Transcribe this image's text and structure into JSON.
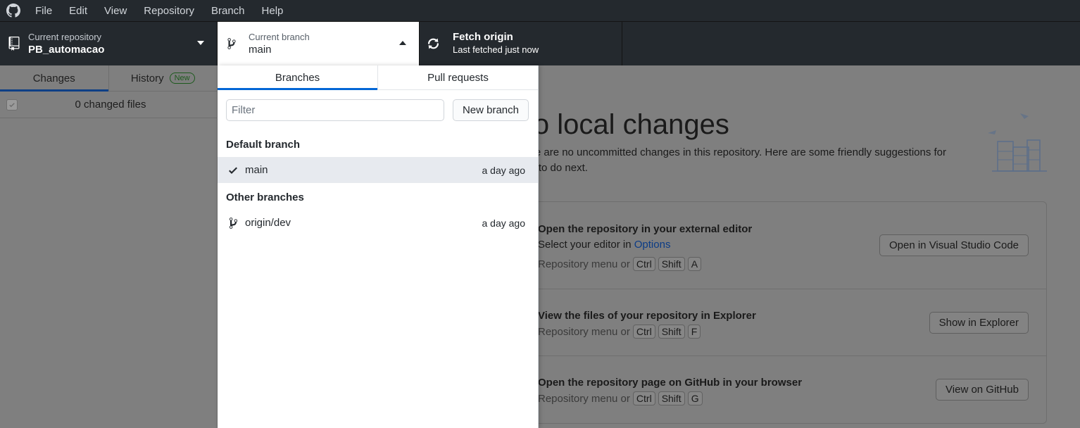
{
  "menubar": {
    "items": [
      "File",
      "Edit",
      "View",
      "Repository",
      "Branch",
      "Help"
    ]
  },
  "toolbar": {
    "repo": {
      "label": "Current repository",
      "value": "PB_automacao"
    },
    "branch": {
      "label": "Current branch",
      "value": "main"
    },
    "fetch": {
      "label": "Fetch origin",
      "sub": "Last fetched just now"
    }
  },
  "sidebar": {
    "tabs": [
      {
        "label": "Changes",
        "active": true
      },
      {
        "label": "History",
        "badge": "New"
      }
    ],
    "changed_files": "0 changed files"
  },
  "main": {
    "title": "No local changes",
    "description": "There are no uncommitted changes in this repository. Here are some friendly suggestions for what to do next.",
    "cards": [
      {
        "title": "Open the repository in your external editor",
        "sub_prefix": "Select your editor in",
        "sub_link": "Options",
        "keys_prefix": "Repository menu or",
        "keys": [
          "Ctrl",
          "Shift",
          "A"
        ],
        "button": "Open in Visual Studio Code"
      },
      {
        "title": "View the files of your repository in Explorer",
        "keys_prefix": "Repository menu or",
        "keys": [
          "Ctrl",
          "Shift",
          "F"
        ],
        "button": "Show in Explorer"
      },
      {
        "title": "Open the repository page on GitHub in your browser",
        "keys_prefix": "Repository menu or",
        "keys": [
          "Ctrl",
          "Shift",
          "G"
        ],
        "button": "View on GitHub"
      }
    ]
  },
  "dropdown": {
    "tabs": [
      {
        "label": "Branches",
        "active": true
      },
      {
        "label": "Pull requests"
      }
    ],
    "filter_placeholder": "Filter",
    "new_branch_label": "New branch",
    "default_section": "Default branch",
    "default_branch": {
      "name": "main",
      "time": "a day ago",
      "selected": true
    },
    "other_section": "Other branches",
    "other_branches": [
      {
        "name": "origin/dev",
        "time": "a day ago"
      }
    ]
  },
  "colors": {
    "toolbar_bg": "#24292e",
    "accent": "#0366d6",
    "overlay_bg": "#7f7f7f"
  }
}
